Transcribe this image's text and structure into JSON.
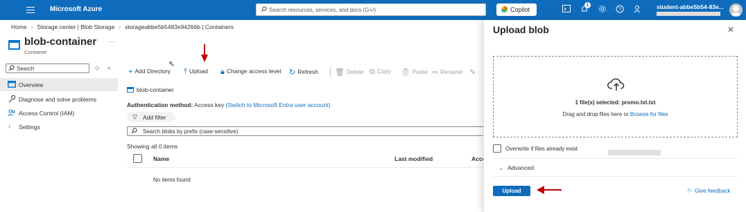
{
  "topbar": {
    "brand": "Microsoft Azure",
    "search_placeholder": "Search resources, services, and docs (G+/)",
    "copilot_label": "Copilot",
    "notification_count": "1",
    "user_name": "student-abbe5b54-83e..."
  },
  "breadcrumb": {
    "items": [
      "Home",
      "Storage center | Blob Storage",
      "storageabbe5b5483e94266b | Containers"
    ]
  },
  "resource": {
    "title": "blob-container",
    "subtitle": "Container",
    "more": "···"
  },
  "left_nav": {
    "search_placeholder": "Search",
    "items": [
      {
        "label": "Overview",
        "icon": "overview-icon"
      },
      {
        "label": "Diagnose and solve problems",
        "icon": "wrench-icon"
      },
      {
        "label": "Access Control (IAM)",
        "icon": "people-icon"
      },
      {
        "label": "Settings",
        "icon": "chevron-right-icon"
      }
    ]
  },
  "toolbar": {
    "add_directory": "Add Directory",
    "upload": "Upload",
    "change_access": "Change access level",
    "refresh": "Refresh",
    "delete": "Delete",
    "copy": "Copy",
    "paste": "Paste",
    "rename": "Rename"
  },
  "content": {
    "container_name": "blob-container",
    "auth_label": "Authentication method:",
    "auth_value": "Access key",
    "auth_link": "(Switch to Microsoft Entra user account)",
    "filter_label": "Add filter",
    "blob_search_placeholder": "Search blobs by prefix (case-sensitive)",
    "showing": "Showing all 0 items",
    "columns": [
      "Name",
      "Last modified",
      "Acce"
    ],
    "empty_message": "No items found"
  },
  "panel": {
    "title": "Upload blob",
    "files_selected": "1 file(s) selected: promo.txt.txt",
    "drag_hint": "Drag and drop files here",
    "or": "or",
    "browse_link": "Browse for files",
    "overwrite_label": "Overwrite if files already exist",
    "advanced_label": "Advanced",
    "upload_button": "Upload",
    "feedback_link": "Give feedback"
  },
  "colors": {
    "accent": "#0f6cbd",
    "annotation_arrow": "#c00000"
  }
}
